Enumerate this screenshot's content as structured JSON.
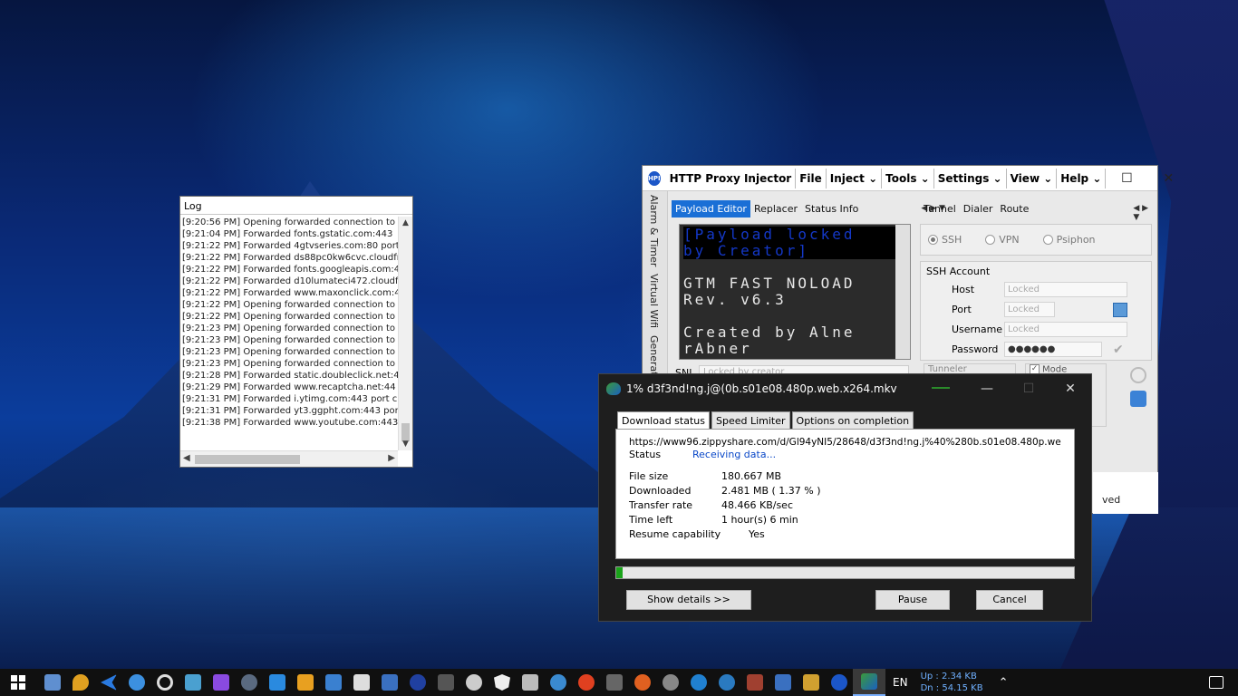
{
  "log_window": {
    "title": "Log",
    "lines": [
      "[9:20:56 PM] Opening forwarded connection to",
      "[9:21:04 PM] Forwarded fonts.gstatic.com:443",
      "[9:21:22 PM] Forwarded 4gtvseries.com:80 port",
      "[9:21:22 PM] Forwarded ds88pc0kw6cvc.cloudfr",
      "[9:21:22 PM] Forwarded fonts.googleapis.com:4",
      "[9:21:22 PM] Forwarded d10lumateci472.cloudfr",
      "[9:21:22 PM] Forwarded www.maxonclick.com:4",
      "[9:21:22 PM] Opening forwarded connection to",
      "[9:21:22 PM] Opening forwarded connection to",
      "[9:21:23 PM] Opening forwarded connection to",
      "[9:21:23 PM] Opening forwarded connection to",
      "[9:21:23 PM] Opening forwarded connection to",
      "[9:21:23 PM] Opening forwarded connection to",
      "[9:21:28 PM] Forwarded static.doubleclick.net:4",
      "[9:21:29 PM] Forwarded www.recaptcha.net:44",
      "[9:21:31 PM] Forwarded i.ytimg.com:443 port cl",
      "[9:21:31 PM] Forwarded yt3.ggpht.com:443 por",
      "[9:21:38 PM] Forwarded www.youtube.com:443"
    ]
  },
  "hpi": {
    "logo": "HPI",
    "title": "HTTP Proxy Injector",
    "menus": [
      "File",
      "Inject",
      "Tools",
      "Settings",
      "View",
      "Help"
    ],
    "side_tabs": [
      "Alarm & Timer",
      "Virtual Wifi",
      "Generator"
    ],
    "left_tabs": [
      "Payload Editor",
      "Replacer",
      "Status Info"
    ],
    "right_tabs": [
      "Tunnel",
      "Dialer",
      "Route"
    ],
    "payload": {
      "locked_line1": "[Payload locked",
      "locked_line2": " by Creator]",
      "line3": "GTM FAST NOLOAD",
      "line4": " Rev. v6.3",
      "line5": "Created by Alne",
      "line6": "rAbner"
    },
    "sni_label": "SNI",
    "sni_value": "Locked by creator",
    "radios": [
      "SSH",
      "VPN",
      "Psiphon"
    ],
    "ssh_account": {
      "legend": "SSH Account",
      "host_label": "Host",
      "host_value": "Locked",
      "port_label": "Port",
      "port_value": "Locked",
      "username_label": "Username",
      "username_value": "Locked",
      "password_label": "Password",
      "password_value": "●●●●●●"
    },
    "tunneller_label": "Tunneler",
    "mode_label": "Mode",
    "status_fragment": "ved"
  },
  "idm": {
    "title": "1% d3f3nd!ng.j@(0b.s01e08.480p.web.x264.mkv",
    "tabs": [
      "Download status",
      "Speed Limiter",
      "Options on completion"
    ],
    "url": "https://www96.zippyshare.com/d/Gl94yNI5/28648/d3f3nd!ng.j%40%280b.s01e08.480p.web.x264",
    "status_label": "Status",
    "status_value": "Receiving data...",
    "file_size_label": "File size",
    "file_size_value": "180.667  MB",
    "downloaded_label": "Downloaded",
    "downloaded_value": "2.481  MB  ( 1.37 % )",
    "transfer_label": "Transfer rate",
    "transfer_value": "48.466  KB/sec",
    "time_left_label": "Time left",
    "time_left_value": "1 hour(s) 6 min",
    "resume_label": "Resume capability",
    "resume_value": "Yes",
    "progress_percent": 1.37,
    "show_details": "Show details >>",
    "pause": "Pause",
    "cancel": "Cancel"
  },
  "taskbar": {
    "lang": "EN",
    "up": "Up : 2.34 KB",
    "dn": "Dn : 54.15 KB"
  }
}
